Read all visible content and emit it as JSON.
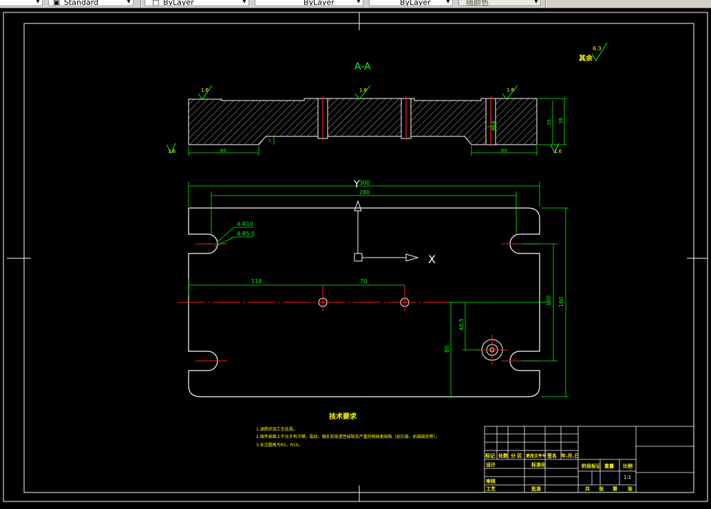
{
  "toolbar": {
    "text_style": "Standard",
    "color": "ByLayer",
    "linetype": "ByLayer",
    "lineweight": "ByLayer",
    "plot_style": "随颜色"
  },
  "drawing": {
    "section_title": "A-A",
    "roughness_other": "其余",
    "roughness_main": "6.3",
    "roughness_marks": [
      "1.6",
      "1.6",
      "1.6",
      "1.6",
      "1.6",
      "1.6"
    ],
    "top_dims": {
      "left_60": "60",
      "right_60": "60",
      "depth_5": "5",
      "h_35": "35",
      "h_38": "38",
      "dia_18": "Φ18"
    },
    "plan_dims": {
      "w_300": "300",
      "w_280": "280",
      "d_119": "119",
      "d_70": "70",
      "v_100": "100",
      "v_160": "160",
      "v_80": "80",
      "v_40_5": "40.5",
      "r10": "4-R10",
      "r5_5": "4-R5.5"
    },
    "ucs_y": "Y",
    "ucs_x": "X",
    "notes_title": "技术要求",
    "notes": [
      "1.调质后加工至此规。",
      "2.铸件表面上不允许有冷隔、裂纹、缩孔和穿透性缺陷及严重的残缺类缺陷（如欠铸、机械损伤等）。",
      "3.未注圆角为R5，R10。"
    ]
  },
  "title_block": {
    "labels_row": [
      "标记",
      "处数",
      "分 区",
      "更改文件号",
      "签名",
      "年.月.日"
    ],
    "design": "设计",
    "standard": "标准化",
    "stage_labels": [
      "阶段标记",
      "重量",
      "比例"
    ],
    "scale": "1:1",
    "review": "审核",
    "process": "工艺",
    "approve": "批准",
    "sheets": [
      "共",
      "张",
      "第",
      "张"
    ]
  }
}
